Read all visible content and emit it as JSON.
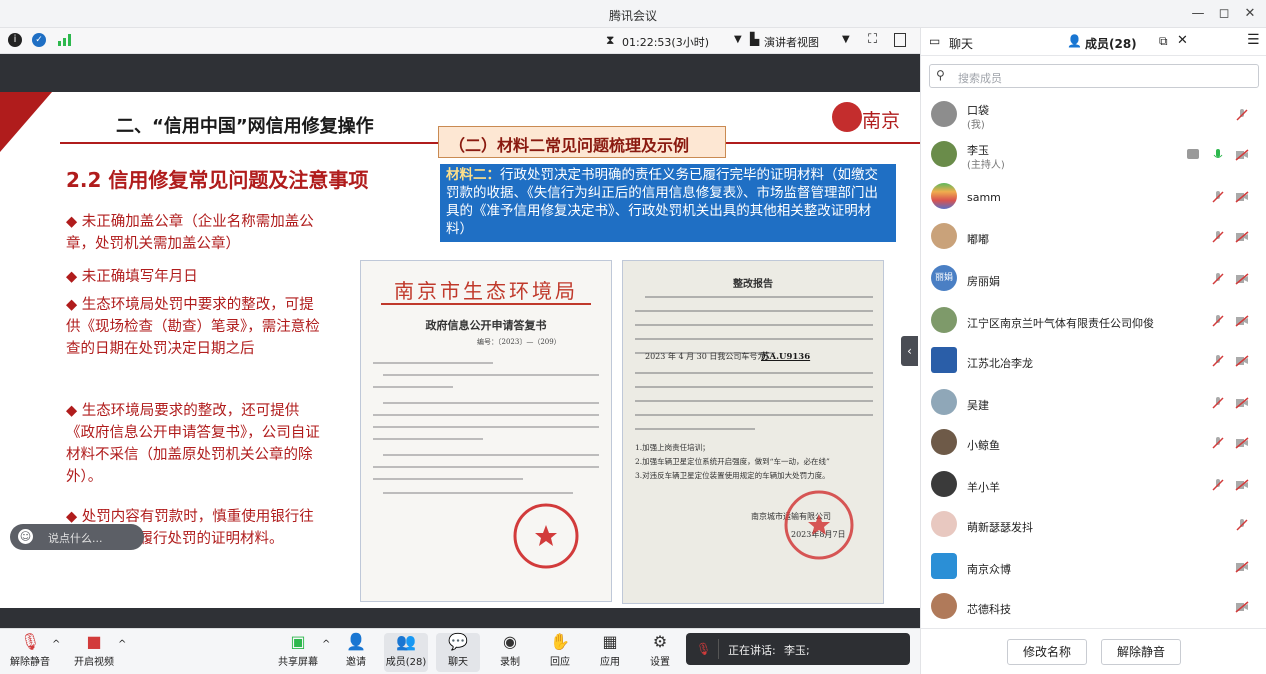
{
  "window": {
    "title": "腾讯会议",
    "controls": [
      "—",
      "◻",
      "✕"
    ]
  },
  "toolbar": {
    "timer": "01:22:53(3小时)",
    "view_mode": "演讲者视图"
  },
  "slide": {
    "section_title": "二、“信用中国”网信用修复操作",
    "material_title": "（二）材料二常见问题梳理及示例",
    "logo_text": "南京",
    "main_heading": "2.2 信用修复常见问题及注意事项",
    "material_box": {
      "label": "材料二：",
      "text": "行政处罚决定书明确的责任义务已履行完毕的证明材料（如缴交罚款的收据、《失信行为纠正后的信用信息修复表》、市场监督管理部门出具的《准予信用修复决定书》、行政处罚机关出具的其他相关整改证明材料）"
    },
    "bullets": [
      "未正确加盖公章（企业名称需加盖公章，处罚机关需加盖公章）",
      "未正确填写年月日",
      "生态环境局处罚中要求的整改，可提供《现场检查（勘查）笔录》，需注意检查的日期在处罚决定日期之后",
      "生态环境局要求的整改，还可提供《政府信息公开申请答复书》，公司自证材料不采信（加盖原处罚机关公章的除外）。",
      "处罚内容有罚款时，慎重使用银行往来票据作为履行处罚的证明材料。"
    ],
    "doc1": {
      "agency": "南京市生态环境局",
      "title": "政府信息公开申请答复书",
      "number": "编号：〔2023〕—（209）"
    },
    "doc2": {
      "title": "整改报告",
      "plate": "苏A.U9136",
      "date_line": "2023 年 4 月 30 日我公司车号为",
      "items": [
        "1.加强上岗责任培训；",
        "2.加强车辆卫星定位系统开启强度，做到“车一动，必在线”",
        "3.对违反车辆卫星定位装置使用规定的车辆加大处罚力度。"
      ],
      "signature": "南京城市运输有限公司",
      "sign_date": "2023年8月7日"
    },
    "comment_placeholder": "说点什么..."
  },
  "bottom_tools": {
    "unmute": "解除静音",
    "video": "开启视频",
    "share": "共享屏幕",
    "invite": "邀请",
    "members": "成员(28)",
    "chat": "聊天",
    "record": "录制",
    "react": "回应",
    "apps": "应用",
    "settings": "设置",
    "speaking_label": "正在讲话:",
    "speaking_name": "李玉;"
  },
  "panel": {
    "tab_chat": "聊天",
    "tab_members": "成员(28)",
    "search_placeholder": "搜索成员",
    "members": [
      {
        "name": "口袋",
        "sub": "(我)"
      },
      {
        "name": "李玉",
        "sub": "(主持人)"
      },
      {
        "name": "samm"
      },
      {
        "name": "嘟嘟"
      },
      {
        "name": "房丽娟",
        "avatar_text": "丽娟"
      },
      {
        "name": "江宁区南京兰叶气体有限责任公司仰俊"
      },
      {
        "name": "江苏北冶李龙"
      },
      {
        "name": "吴建"
      },
      {
        "name": "小鲸鱼"
      },
      {
        "name": "羊小羊"
      },
      {
        "name": "萌新瑟瑟发抖"
      },
      {
        "name": "南京众博"
      },
      {
        "name": "芯德科技"
      }
    ],
    "rename_button": "修改名称",
    "unmute_button": "解除静音"
  },
  "colors": {
    "slide_red": "#b01c1c",
    "accent_blue": "#1f6fc4",
    "mic_green": "#2db84d"
  }
}
